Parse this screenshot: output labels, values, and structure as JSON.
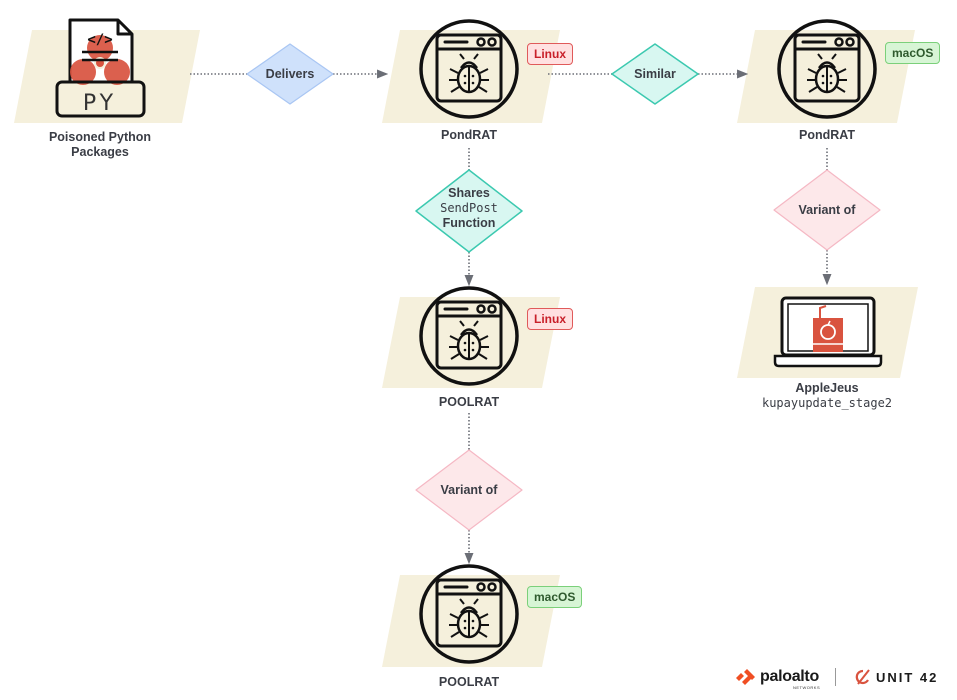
{
  "colors": {
    "node_bg": "#f5f0dc",
    "edge": "#6b6e76",
    "diamond_blue_fill": "#cfe1fb",
    "diamond_blue_stroke": "#a9c6f3",
    "diamond_teal_fill": "#d8f7f1",
    "diamond_teal_stroke": "#3cc9b0",
    "diamond_pink_fill": "#fde8ea",
    "diamond_pink_stroke": "#f5b8c4",
    "icon_red": "#d9533f"
  },
  "nodes": {
    "poisoned_packages": {
      "label_line1": "Poisoned Python",
      "label_line2": "Packages",
      "icon": "biohazard-python-file-icon",
      "py_text": "PY",
      "code_text": "</>"
    },
    "pondrat_linux": {
      "label": "PondRAT",
      "badge": "Linux",
      "icon": "malware-window-bug-icon"
    },
    "pondrat_macos": {
      "label": "PondRAT",
      "badge": "macOS",
      "icon": "malware-window-bug-icon"
    },
    "poolrat_linux": {
      "label": "POOLRAT",
      "badge": "Linux",
      "icon": "malware-window-bug-icon"
    },
    "poolrat_macos": {
      "label": "POOLRAT",
      "badge": "macOS",
      "icon": "malware-window-bug-icon"
    },
    "applejeus": {
      "label": "AppleJeus",
      "sublabel": "kupayupdate_stage2",
      "icon": "laptop-juicebox-icon"
    }
  },
  "relations": {
    "delivers": {
      "label": "Delivers"
    },
    "similar": {
      "label": "Similar"
    },
    "shares": {
      "line1": "Shares",
      "line2": "SendPost",
      "line3": "Function"
    },
    "variant_of_right": {
      "label": "Variant of"
    },
    "variant_of_center": {
      "label": "Variant of"
    }
  },
  "footer": {
    "paloalto": "paloalto",
    "paloalto_sub": "NETWORKS",
    "unit42": "UNIT 42"
  }
}
